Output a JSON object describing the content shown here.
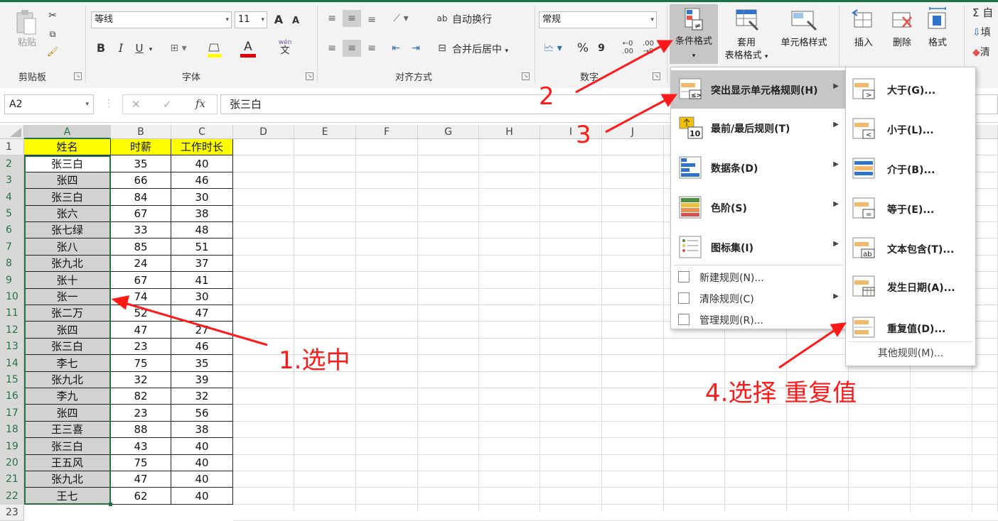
{
  "ribbon": {
    "clipboard": {
      "paste": "粘贴",
      "label": "剪贴板"
    },
    "font": {
      "name": "等线",
      "size": "11",
      "bold": "B",
      "italic": "I",
      "underline": "U",
      "grow": "A",
      "shrink": "A",
      "font_color_letter": "A",
      "phonetic": "wén",
      "phonetic2": "文",
      "label": "字体"
    },
    "align": {
      "wrap": "自动换行",
      "merge": "合并后居中",
      "label": "对齐方式"
    },
    "number": {
      "format": "常规",
      "percent": "%",
      "comma": "9",
      "label": "数字"
    },
    "styles": {
      "conditional": "条件格式",
      "table1": "套用",
      "table2": "表格格式",
      "cellstyle": "单元格样式"
    },
    "cells": {
      "insert": "插入",
      "delete": "删除",
      "format": "格式"
    },
    "editing": {
      "sum": "Σ 自",
      "fill": "填",
      "clear": "清"
    }
  },
  "formula_bar": {
    "name_box": "A2",
    "cancel": "✕",
    "enter": "✓",
    "fx": "fx",
    "content": "张三白"
  },
  "columns": [
    "A",
    "B",
    "C",
    "D",
    "E",
    "F",
    "G",
    "H",
    "I",
    "J"
  ],
  "headers": [
    "姓名",
    "时薪",
    "工作时长"
  ],
  "rows": [
    [
      "张三白",
      "35",
      "40"
    ],
    [
      "张四",
      "66",
      "46"
    ],
    [
      "张三白",
      "84",
      "30"
    ],
    [
      "张六",
      "67",
      "38"
    ],
    [
      "张七绿",
      "33",
      "48"
    ],
    [
      "张八",
      "85",
      "51"
    ],
    [
      "张九北",
      "24",
      "37"
    ],
    [
      "张十",
      "67",
      "41"
    ],
    [
      "张一",
      "74",
      "30"
    ],
    [
      "张二万",
      "52",
      "47"
    ],
    [
      "张四",
      "47",
      "27"
    ],
    [
      "张三白",
      "23",
      "46"
    ],
    [
      "李七",
      "75",
      "35"
    ],
    [
      "张九北",
      "32",
      "39"
    ],
    [
      "李九",
      "82",
      "32"
    ],
    [
      "张四",
      "23",
      "56"
    ],
    [
      "王三喜",
      "88",
      "38"
    ],
    [
      "张三白",
      "43",
      "40"
    ],
    [
      "王五风",
      "75",
      "40"
    ],
    [
      "张九北",
      "47",
      "40"
    ],
    [
      "王七",
      "62",
      "40"
    ]
  ],
  "menu": {
    "items": [
      {
        "label": "突出显示单元格规则(H)"
      },
      {
        "label": "最前/最后规则(T)"
      },
      {
        "label": "数据条(D)"
      },
      {
        "label": "色阶(S)"
      },
      {
        "label": "图标集(I)"
      }
    ],
    "small_items": [
      {
        "label": "新建规则(N)..."
      },
      {
        "label": "清除规则(C)"
      },
      {
        "label": "管理规则(R)..."
      }
    ]
  },
  "submenu": {
    "items": [
      {
        "label": "大于(G)..."
      },
      {
        "label": "小于(L)..."
      },
      {
        "label": "介于(B)..."
      },
      {
        "label": "等于(E)..."
      },
      {
        "label": "文本包含(T)..."
      },
      {
        "label": "发生日期(A)..."
      },
      {
        "label": "重复值(D)..."
      }
    ],
    "more": "其他规则(M)..."
  },
  "annotations": {
    "step1": "1.选中",
    "step2": "2",
    "step3": "3",
    "step4": "4.选择 重复值"
  },
  "colors": {
    "header_fill": "#ffff00",
    "selection": "#d2d2d2",
    "annotation": "#ff1a1a",
    "excel_green": "#1e7145"
  }
}
